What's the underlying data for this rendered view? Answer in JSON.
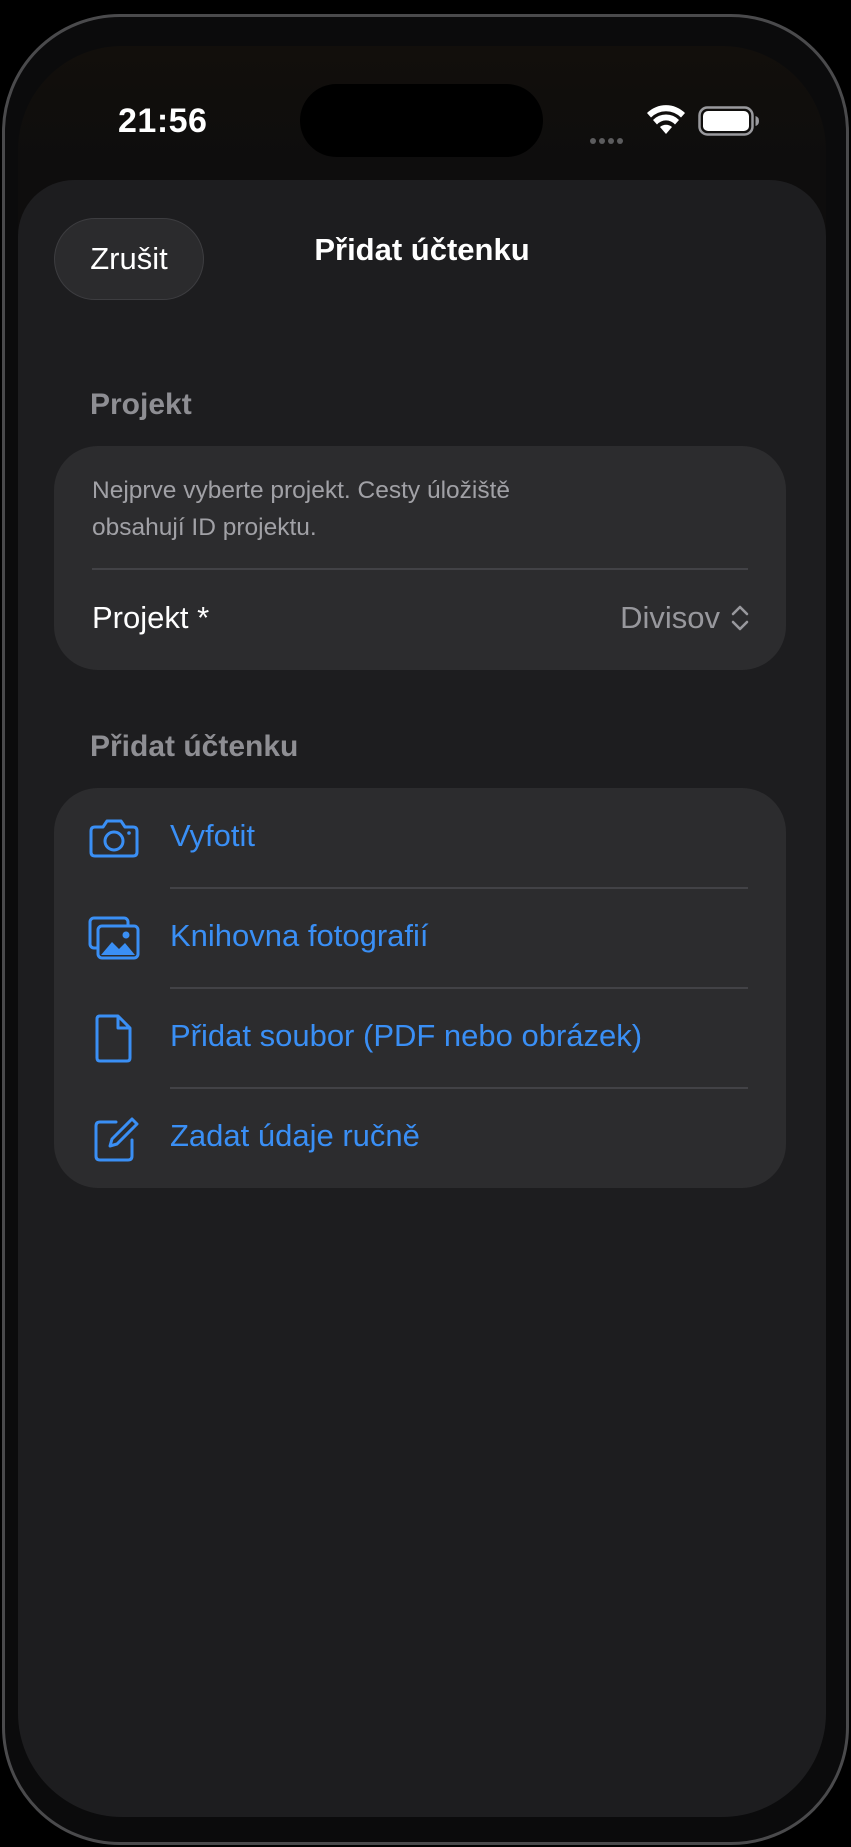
{
  "status_bar": {
    "time": "21:56"
  },
  "sheet": {
    "cancel_label": "Zrušit",
    "title": "Přidat účtenku"
  },
  "project_section": {
    "header": "Projekt",
    "info_line_1": "Nejprve vyberte projekt. Cesty úložiště",
    "info_line_2": "obsahují ID projektu.",
    "row_label": "Projekt *",
    "selected_value": "Divisov"
  },
  "receipt_section": {
    "header": "Přidat účtenku",
    "actions": [
      {
        "label": "Vyfotit",
        "icon": "camera-icon"
      },
      {
        "label": "Knihovna fotografií",
        "icon": "photo-library-icon"
      },
      {
        "label": "Přidat soubor (PDF nebo obrázek)",
        "icon": "document-icon"
      },
      {
        "label": "Zadat údaje ručně",
        "icon": "square-pencil-icon"
      }
    ]
  },
  "colors": {
    "accent": "#3a8ff5",
    "sheet_background": "#1d1d1f",
    "card_background": "#2c2c2e"
  }
}
